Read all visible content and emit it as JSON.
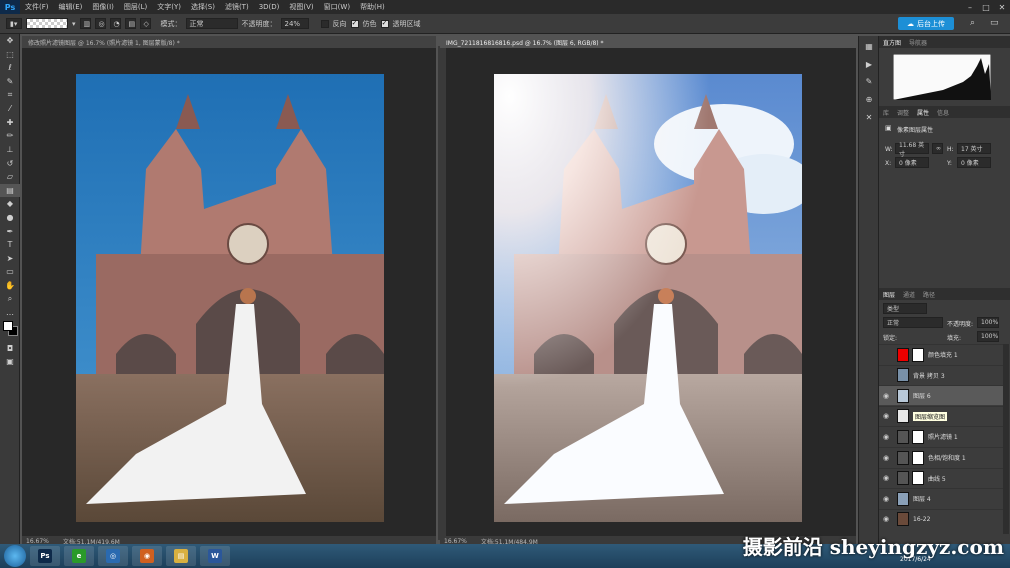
{
  "app": {
    "logo": "Ps",
    "menus": [
      "文件(F)",
      "编辑(E)",
      "图像(I)",
      "图层(L)",
      "文字(Y)",
      "选择(S)",
      "滤镜(T)",
      "3D(D)",
      "视图(V)",
      "窗口(W)",
      "帮助(H)"
    ],
    "win_controls": [
      "–",
      "□",
      "✕"
    ]
  },
  "options": {
    "mode_label": "模式：",
    "mode_value": "正常",
    "opacity_label": "不透明度：",
    "opacity_value": "24%",
    "reverse_label": "反向",
    "dither_label": "仿色",
    "transparency_label": "透明区域",
    "upload_label": "后台上传"
  },
  "doc_left": {
    "tab": "修改照片滤镜图层 @ 16.7% (照片滤镜 1, 图层蒙版/8) *",
    "zoom": "16.67%",
    "doc_size": "文档:51.1M/419.6M"
  },
  "doc_right": {
    "tab": "IMG_7211816816816.psd @ 16.7% (图层 6, RGB/8) *",
    "zoom": "16.67%",
    "doc_size": "文档:51.1M/484.9M"
  },
  "histogram_panel": {
    "tabs": [
      "直方图",
      "导航器"
    ]
  },
  "properties_panel": {
    "tabs": [
      "库",
      "调整",
      "属性",
      "信息"
    ],
    "title": "像素图层属性",
    "w_label": "W:",
    "w_value": "11.68 英寸",
    "h_label": "H:",
    "h_value": "17 英寸",
    "x_label": "X:",
    "x_value": "0 像素",
    "y_label": "Y:",
    "y_value": "0 像素",
    "link_symbol": "∞"
  },
  "layers_panel": {
    "tabs": [
      "图层",
      "通道",
      "路径"
    ],
    "filter_kind": "类型",
    "blend_mode": "正常",
    "opacity_label": "不透明度:",
    "opacity_value": "100%",
    "lock_label": "锁定:",
    "fill_label": "填充:",
    "fill_value": "100%",
    "layers": [
      {
        "name": "颜色填充 1",
        "thumb": "#e00",
        "visible": false,
        "mask": true
      },
      {
        "name": "背景 拷贝 3",
        "thumb": "#7890a8",
        "visible": false,
        "mask": false
      },
      {
        "name": "图层 6",
        "thumb": "#b8c8d8",
        "visible": true,
        "mask": false,
        "selected": true
      },
      {
        "name": "图层缩览图",
        "thumb": "#e8e8e8",
        "visible": true,
        "mask": false,
        "tooltip": true
      },
      {
        "name": "照片滤镜 1",
        "thumb": "#555",
        "visible": true,
        "mask": true
      },
      {
        "name": "色相/饱和度 1",
        "thumb": "#555",
        "visible": true,
        "mask": true
      },
      {
        "name": "曲线 5",
        "thumb": "#555",
        "visible": true,
        "mask": true
      },
      {
        "name": "图层 4",
        "thumb": "#8aa0b8",
        "visible": true,
        "mask": false
      },
      {
        "name": "16-22",
        "thumb": "#6a4a3a",
        "visible": true,
        "mask": false
      }
    ]
  },
  "taskbar": {
    "date": "2017/6/24",
    "apps": [
      {
        "label": "Ps",
        "color": "#0e2a4a"
      },
      {
        "label": "e",
        "color": "#2a9a2a"
      },
      {
        "label": "◎",
        "color": "#2a6ab0"
      },
      {
        "label": "◉",
        "color": "#d06020"
      },
      {
        "label": "▤",
        "color": "#d8b040"
      },
      {
        "label": "W",
        "color": "#2b579a"
      }
    ]
  },
  "watermark": "摄影前沿 sheyingzyz.com"
}
